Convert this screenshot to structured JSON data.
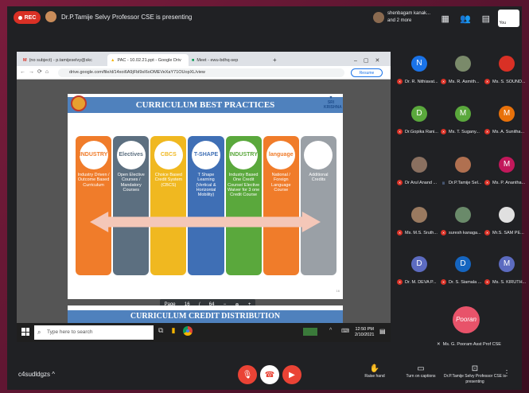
{
  "meet": {
    "rec_label": "REC",
    "presenting_text": "Dr.P.Tamije Selvy Professor CSE is presenting",
    "top_people_line1": "shenbagam kanak...",
    "top_people_line2": "and 2 more",
    "you_label": "You",
    "meeting_code": "c4sudldgzs",
    "raise_hand": "Raise hand",
    "captions": "Turn on captions",
    "presenting_label": "Dr.P.Tamije Selvy Professor CSE is presenting"
  },
  "browser": {
    "tabs": [
      {
        "label": "(no subject) - p.tamijeselvy@skc"
      },
      {
        "label": "PAC - 10.02.21.ppt - Google Driv"
      },
      {
        "label": "Meet - ewu-bdhq-sep"
      }
    ],
    "url": "drive.google.com/file/d/14xoi6A9jFbl9sI6oOMEVeXaY71OUopXL/view",
    "resume_label": "Resume"
  },
  "slide": {
    "title": "CURRICULUM  BEST PRACTICES",
    "logo_right": "SRI KRISHNA",
    "cards": [
      {
        "icon": "INDUSTRY",
        "text": "Industry Driven / Outcome Based Curriculum",
        "color": "#f07c2a"
      },
      {
        "icon": "Electives",
        "text": "Open Elective Courses / Mandatory Courses",
        "color": "#5c6f80"
      },
      {
        "icon": "CBCS",
        "text": "Choice Based Credit System (CBCS)",
        "color": "#f0b820"
      },
      {
        "icon": "T-SHAPE",
        "text": "T Shape Learning (Vertical & Horizontal Mobility)",
        "color": "#3f6fb5"
      },
      {
        "icon": "INDUSTRY",
        "text": "Industry Based One Credit Course/ Elective Waiver for 3 one Credit Course",
        "color": "#5aa83c"
      },
      {
        "icon": "language",
        "text": "National / Foreign Language Course",
        "color": "#f07c2a"
      },
      {
        "icon": "",
        "text": "Additional Credits",
        "color": "#9aa0a6"
      }
    ],
    "slide_number": "16",
    "next_title": "CURRICULUM  CREDIT DISTRIBUTION"
  },
  "pager": {
    "page_label": "Page",
    "current": "16",
    "sep": "/",
    "total": "64",
    "minus": "−",
    "plus": "+"
  },
  "taskbar": {
    "search_placeholder": "Type here to search",
    "time": "12:50 PM",
    "date": "2/10/2021"
  },
  "participants": [
    {
      "name": "Dr. R. Nithiavat...",
      "initial": "N",
      "color": "#1a73e8"
    },
    {
      "name": "Ms. R. Asmith...",
      "initial": "",
      "color": "#7a8a6a"
    },
    {
      "name": "Ms. S. SOUND...",
      "initial": "",
      "color": "#d93025"
    },
    {
      "name": "Dr.Gopika Rani...",
      "initial": "D",
      "color": "#5aa83c"
    },
    {
      "name": "Ms. T. Sugany...",
      "initial": "M",
      "color": "#5aa83c"
    },
    {
      "name": "Ms. A. Sunitha...",
      "initial": "M",
      "color": "#e8710a"
    },
    {
      "name": "Dr Arul Anand ...",
      "initial": "",
      "color": "#8a7060"
    },
    {
      "name": "Dr.P.Tamije Sel...",
      "initial": "",
      "color": "#b07050"
    },
    {
      "name": "Ms. P. Anantha...",
      "initial": "M",
      "color": "#c2185b"
    },
    {
      "name": "Ms. M.S. Sruth...",
      "initial": "",
      "color": "#9a7a60"
    },
    {
      "name": "suresh kanaga...",
      "initial": "",
      "color": "#6a8a6a"
    },
    {
      "name": "Mr.S. SAM PE...",
      "initial": "",
      "color": "#e0e0e0"
    },
    {
      "name": "Dr. M. DEVA P...",
      "initial": "D",
      "color": "#5c6bc0"
    },
    {
      "name": "Dr. S. Siamala ...",
      "initial": "D",
      "color": "#1565c0"
    },
    {
      "name": "Ms. S. KIRUTH...",
      "initial": "M",
      "color": "#5c6bc0"
    }
  ],
  "big_participant": {
    "name": "Ms. G. Pooram Asst Prof CSE",
    "avatar_text": "Pooran"
  }
}
